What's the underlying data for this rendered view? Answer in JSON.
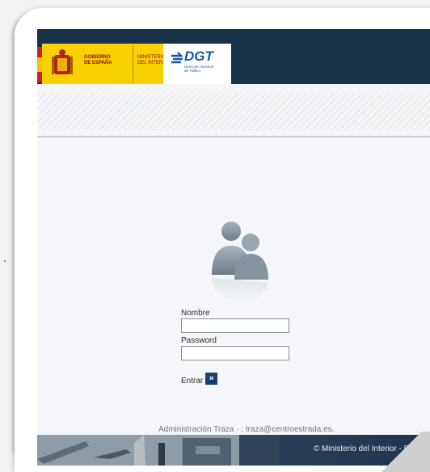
{
  "header": {
    "gov_logo_text": "GOBIERNO\nDE ESPAÑA",
    "ministry_logo_text": "MINISTERIO\nDEL INTERIOR",
    "dgt_logo_text": "DGT",
    "dgt_logo_subtitle": "Dirección General\nde Tráfico"
  },
  "login": {
    "username_label": "Nombre",
    "username_value": "",
    "password_label": "Password",
    "password_value": "",
    "submit_label": "Entrar",
    "submit_icon": "»"
  },
  "footer": {
    "admin_text": "Administración Traza · : traza@centroestrada.es.",
    "copyright": "© Ministerio del Interior - D.G.T."
  },
  "colors": {
    "header_bg": "#183249",
    "gov_yellow": "#f9d100",
    "dgt_blue": "#1a56a8",
    "button_bg": "#1b3d69"
  }
}
